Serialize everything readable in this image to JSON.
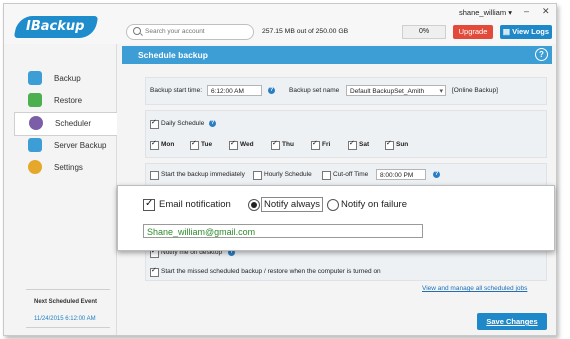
{
  "brand": {
    "logo_text": "IBackup"
  },
  "topbar": {
    "user_name": "shane_william",
    "user_menu_icon": "chevron-down-icon",
    "search_placeholder": "Search your account",
    "quota_text": "257.15 MB out of 250.00 GB",
    "usage_percent": "0%",
    "upgrade_label": "Upgrade",
    "view_logs_label": "View Logs"
  },
  "sidebar": {
    "items": [
      {
        "label": "Backup",
        "icon": "cloud-upload-icon",
        "color": "#3d9ed6"
      },
      {
        "label": "Restore",
        "icon": "cloud-download-icon",
        "color": "#4caf50"
      },
      {
        "label": "Scheduler",
        "icon": "clock-icon",
        "color": "#7b5ea7"
      },
      {
        "label": "Server Backup",
        "icon": "server-icon",
        "color": "#3d9ed6"
      },
      {
        "label": "Settings",
        "icon": "gear-icon",
        "color": "#e5a82a"
      }
    ],
    "next_event_label": "Next Scheduled Event",
    "next_event_date": "11/24/2015 6:12:00 AM"
  },
  "main": {
    "title": "Schedule backup",
    "start_time_label": "Backup start time:",
    "start_time_value": "6:12:00 AM",
    "backup_set_label": "Backup set name",
    "backup_set_value": "Default BackupSet_Amith",
    "backup_set_type": "[Online Backup]",
    "daily_schedule_label": "Daily Schedule",
    "days": [
      "Mon",
      "Tue",
      "Wed",
      "Thu",
      "Fri",
      "Sat",
      "Sun"
    ],
    "start_immediately_label": "Start the backup immediately",
    "hourly_label": "Hourly Schedule",
    "cutoff_label": "Cut-off Time",
    "cutoff_value": "8:00:00 PM",
    "notify_desktop_label": "Notify me on desktop",
    "missed_label": "Start the missed scheduled backup / restore when the computer is turned on",
    "manage_link": "View and manage all scheduled jobs",
    "save_label": "Save Changes"
  },
  "popup": {
    "email_notification_label": "Email notification",
    "notify_always_label": "Notify always",
    "notify_failure_label": "Notify on failure",
    "email_value": "Shane_william@gmail.com"
  }
}
